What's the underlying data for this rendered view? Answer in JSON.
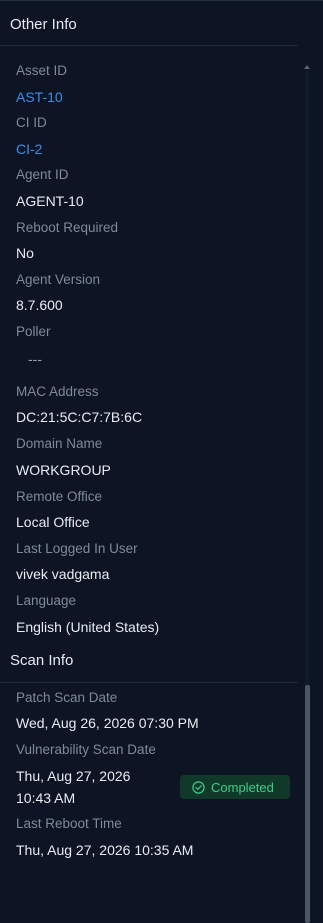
{
  "other_info": {
    "title": "Other Info",
    "fields": [
      {
        "label": "Asset ID",
        "value": "AST-10"
      },
      {
        "label": "CI ID",
        "value": "CI-2"
      },
      {
        "label": "Agent ID",
        "value": "AGENT-10"
      },
      {
        "label": "Reboot Required",
        "value": "No"
      },
      {
        "label": "Agent Version",
        "value": "8.7.600"
      },
      {
        "label": "Poller",
        "value": "---"
      },
      {
        "label": "MAC Address",
        "value": "DC:21:5C:C7:7B:6C"
      },
      {
        "label": "Domain Name",
        "value": "WORKGROUP"
      },
      {
        "label": "Remote Office",
        "value": "Local Office"
      },
      {
        "label": "Last Logged In User",
        "value": "vivek vadgama"
      },
      {
        "label": "Language",
        "value": "English (United States)"
      }
    ]
  },
  "scan_info": {
    "title": "Scan Info",
    "patch_scan": {
      "label": "Patch Scan Date",
      "value": "Wed, Aug 26, 2026 07:30 PM"
    },
    "vuln_scan": {
      "label": "Vulnerability Scan Date",
      "value_line1": "Thu, Aug 27, 2026",
      "value_line2": "10:43 AM",
      "status": "Completed",
      "status_color": "#3ccf86"
    },
    "last_reboot": {
      "label": "Last Reboot Time",
      "value": "Thu, Aug 27, 2026 10:35 AM"
    }
  },
  "colors": {
    "link": "#3b8eea",
    "background": "#0d1423",
    "label": "#7f8a9c",
    "value": "#e8ecf2"
  }
}
